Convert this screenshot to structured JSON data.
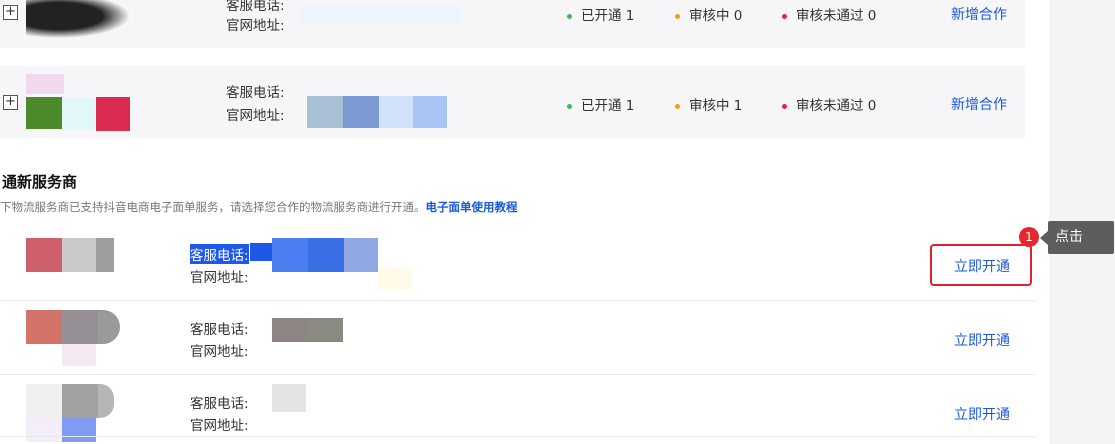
{
  "existing_partners": [
    {
      "phone_label": "客服电话:",
      "site_label": "官网地址:",
      "stats": [
        {
          "label": "已开通",
          "count": "1",
          "color": "#3cbd57"
        },
        {
          "label": "审核中",
          "count": "0",
          "color": "#f2a019"
        },
        {
          "label": "审核未通过",
          "count": "0",
          "color": "#e8243f"
        }
      ],
      "action": "新增合作"
    },
    {
      "phone_label": "客服电话:",
      "site_label": "官网地址:",
      "stats": [
        {
          "label": "已开通",
          "count": "1",
          "color": "#3cbd57"
        },
        {
          "label": "审核中",
          "count": "1",
          "color": "#f2a019"
        },
        {
          "label": "审核未通过",
          "count": "0",
          "color": "#e8243f"
        }
      ],
      "action": "新增合作"
    }
  ],
  "new_section": {
    "title": "通新服务商",
    "description": "下物流服务商已支持抖音电商电子面单服务，请选择您合作的物流服务商进行开通。",
    "tutorial_link": "电子面单使用教程"
  },
  "new_providers": [
    {
      "phone_label": "客服电话:",
      "site_label": "官网地址:",
      "action": "立即开通"
    },
    {
      "phone_label": "客服电话:",
      "site_label": "官网地址:",
      "action": "立即开通"
    },
    {
      "phone_label": "客服电话:",
      "site_label": "官网地址:",
      "action": "立即开通"
    }
  ],
  "guide": {
    "step_number": "1",
    "tooltip": "点击"
  }
}
